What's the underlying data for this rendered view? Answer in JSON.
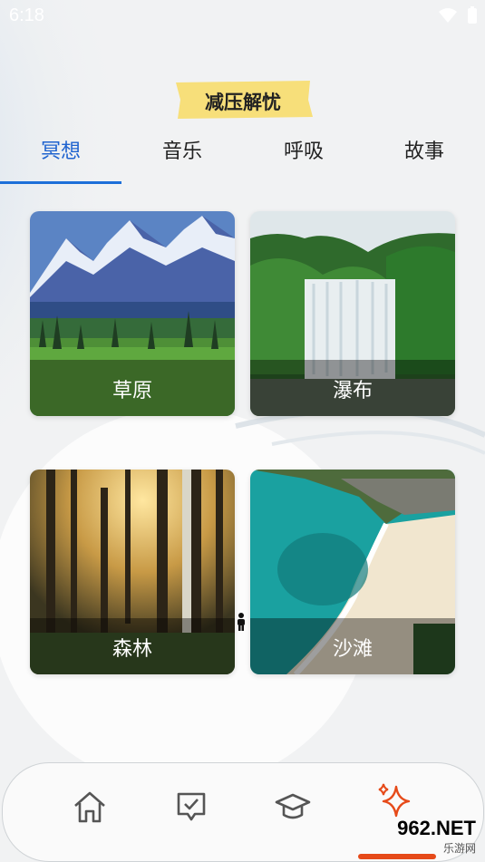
{
  "status_bar": {
    "time": "6:18"
  },
  "header": {
    "title": "减压解忧"
  },
  "tabs": [
    {
      "label": "冥想",
      "active": true
    },
    {
      "label": "音乐",
      "active": false
    },
    {
      "label": "呼吸",
      "active": false
    },
    {
      "label": "故事",
      "active": false
    }
  ],
  "cards": [
    {
      "label": "草原",
      "image": "grassland-mountain"
    },
    {
      "label": "瀑布",
      "image": "waterfall"
    },
    {
      "label": "森林",
      "image": "forest-sunrays"
    },
    {
      "label": "沙滩",
      "image": "beach-coast"
    }
  ],
  "bottom_nav": {
    "items": [
      {
        "icon": "home-icon"
      },
      {
        "icon": "checkbox-message-icon"
      },
      {
        "icon": "graduation-cap-icon"
      },
      {
        "icon": "sparkle-icon",
        "active": true
      }
    ]
  },
  "watermark": {
    "brand_top": "962.NET",
    "brand_bottom": "乐游网"
  },
  "colors": {
    "accent": "#1d6fd9",
    "active_nav": "#e64a19",
    "banner": "#f7df7a"
  }
}
